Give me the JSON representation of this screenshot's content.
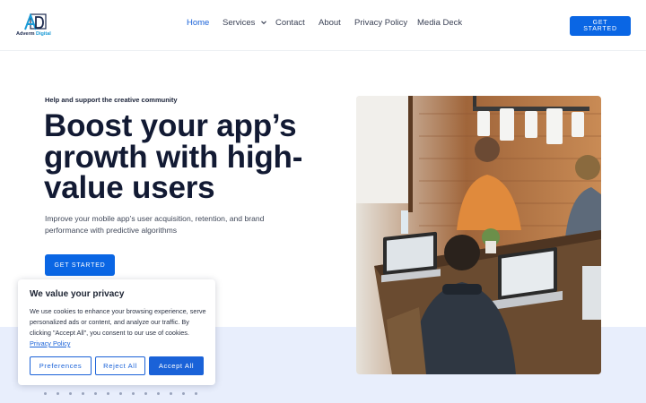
{
  "brand": {
    "logo_mark": "AD",
    "name_part1": "Adverm",
    "name_part2": "Digital"
  },
  "nav": {
    "items": [
      {
        "label": "Home",
        "active": true
      },
      {
        "label": "Services",
        "has_dropdown": true
      },
      {
        "label": "Contact"
      },
      {
        "label": "About"
      },
      {
        "label": "Privacy Policy"
      },
      {
        "label": "Media Deck"
      }
    ],
    "cta_label": "GET STARTED"
  },
  "hero": {
    "eyebrow": "Help and support the creative community",
    "headline_lines": [
      "Boost your app’s",
      "growth with high-",
      "value users"
    ],
    "subtext": "Improve your mobile app’s user acquisition, retention, and brand performance with predictive algorithms",
    "cta_label": "GET STARTED",
    "image_icon": "team-working-laptops-photo"
  },
  "cookie_banner": {
    "title": "We value your privacy",
    "body": "We use cookies to enhance your browsing experience, serve personalized ads or content, and analyze our traffic. By clicking \"Accept All\", you consent to our use of cookies.",
    "policy_link": "Privacy Policy",
    "buttons": {
      "preferences": "Preferences",
      "reject": "Reject All",
      "accept": "Accept All"
    }
  },
  "colors": {
    "accent": "#0a66e4",
    "link": "#1a62d8",
    "headline": "#121a33",
    "band": "#e8eefc"
  }
}
